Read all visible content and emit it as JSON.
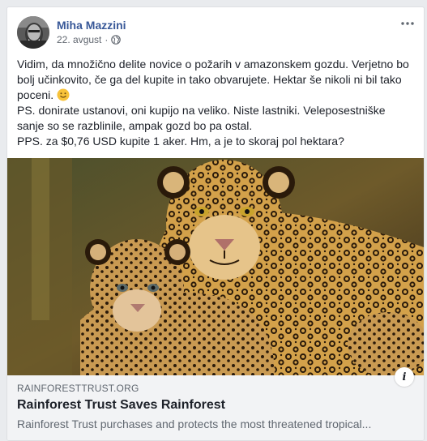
{
  "post": {
    "author": "Miha Mazzini",
    "date": "22. avgust",
    "separator": "·",
    "privacy_icon": "globe-icon",
    "more_icon": "more-horizontal-icon",
    "text": {
      "line1": "Vidim, da množično delite novice o požarih v amazonskem gozdu. Verjetno bo bolj učinkovito, če ga del kupite in tako obvarujete. Hektar še nikoli ni bil tako poceni.",
      "line2": "PS. donirate ustanovi, oni kupijo na veliko. Niste lastniki. Veleposestniške sanje so se razblinile, ampak gozd bo pa ostal.",
      "line3": "PPS. za $0,76 USD kupite 1 aker. Hm, a je to skoraj pol hektara?"
    }
  },
  "link": {
    "domain": "RAINFORESTTRUST.ORG",
    "title": "Rainforest Trust Saves Rainforest",
    "description": "Rainforest Trust purchases and protects the most threatened tropical...",
    "info_label": "i"
  },
  "colors": {
    "author": "#385898",
    "meta": "#616770",
    "text": "#1d2129",
    "card_bg": "#f2f3f5"
  }
}
